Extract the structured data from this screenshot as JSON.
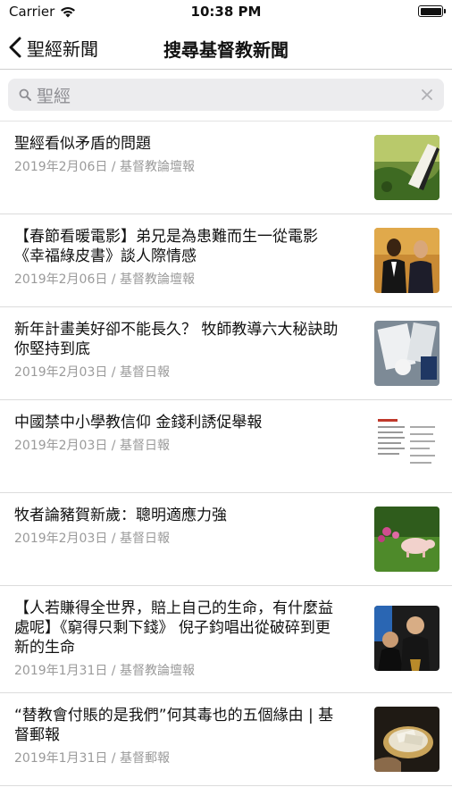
{
  "status": {
    "carrier": "Carrier",
    "time": "10:38 PM"
  },
  "nav": {
    "back_label": "聖經新聞",
    "title": "搜尋基督教新聞"
  },
  "search": {
    "value": "聖經",
    "placeholder": "聖經"
  },
  "articles": [
    {
      "title": "聖經看似矛盾的問題",
      "date": "2019年2月06日",
      "source": "基督教論壇報",
      "thumb_icon": "nature-landscape-image"
    },
    {
      "title": "【春節看暖電影】弟兄是為患難而生一從電影《幸福綠皮書》談人際情感",
      "date": "2019年2月06日",
      "source": "基督教論壇報",
      "thumb_icon": "movie-still-image"
    },
    {
      "title": "新年計畫美好卻不能長久？ 牧師教導六大秘訣助你堅持到底",
      "date": "2019年2月03日",
      "source": "基督日報",
      "thumb_icon": "notebook-desk-image"
    },
    {
      "title": "中國禁中小學教信仰 金錢利誘促舉報",
      "date": "2019年2月03日",
      "source": "基督日報",
      "thumb_icon": "document-scan-image"
    },
    {
      "title": "牧者論豬賀新歲：聰明適應力強",
      "date": "2019年2月03日",
      "source": "基督日報",
      "thumb_icon": "pig-garden-image"
    },
    {
      "title": "【人若賺得全世界，賠上自己的生命，有什麼益處呢】《窮得只剩下錢》 倪子鈞唱出從破碎到更新的生命",
      "date": "2019年1月31日",
      "source": "基督教論壇報",
      "thumb_icon": "people-photo-image"
    },
    {
      "title": "“替教會付賬的是我們”何其毒也的五個緣由 | 基督郵報",
      "date": "2019年1月31日",
      "source": "基督郵報",
      "thumb_icon": "offering-plate-image"
    }
  ],
  "separator": " / "
}
